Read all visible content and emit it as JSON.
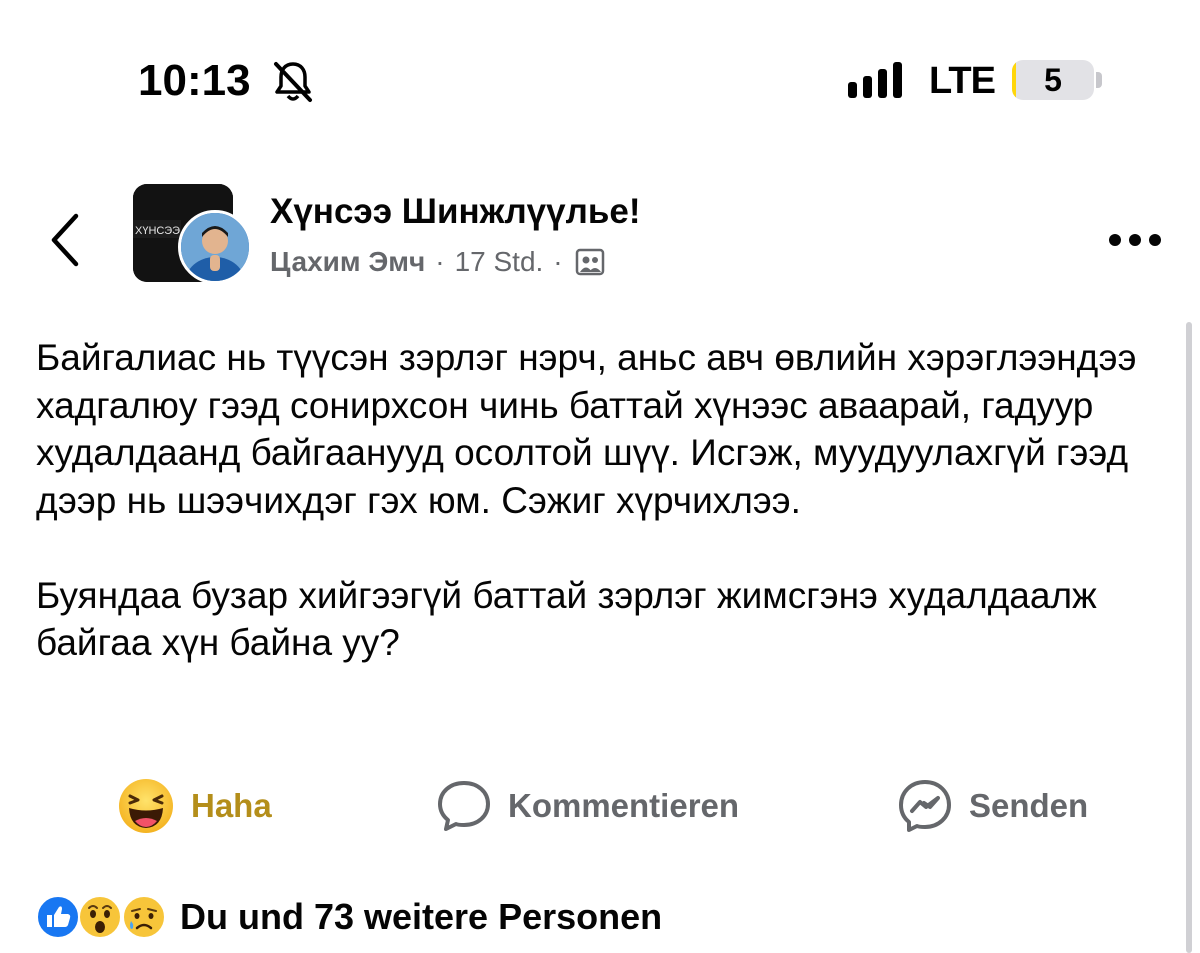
{
  "status_bar": {
    "time": "10:13",
    "network": "LTE",
    "battery": "5",
    "battery_level_percent": 5,
    "icons": [
      "bell-slash-icon",
      "signal-icon",
      "battery-icon"
    ]
  },
  "header": {
    "back_icon": "chevron-left-icon",
    "group_name": "Хүнсээ Шинжлүүлье!",
    "author": "Цахим Эмч",
    "separator": "·",
    "time_ago": "17 Std.",
    "audience_icon": "group-audience-icon",
    "more_icon": "more-icon"
  },
  "post": {
    "paragraphs": [
      "Байгалиас нь түүсэн зэрлэг нэрч, аньс авч өвлийн хэрэглээндээ хадгалюу гээд сонирхсон чинь баттай хүнээс аваарай, гадуур худалдаанд байгаанууд осолтой шүү. Исгэж, муудуулахгүй гээд дээр нь шээчихдэг гэх юм. Сэжиг хүрчихлээ.",
      "Буяндаа бузар хийгээгүй баттай зэрлэг жимсгэнэ худалдаалж байгаа хүн байна уу?"
    ]
  },
  "actions": {
    "haha_label": "Haha",
    "comment_label": "Kommentieren",
    "send_label": "Senden"
  },
  "reactions": {
    "icons": [
      "like-icon",
      "wow-icon",
      "sad-icon"
    ],
    "summary": "Du und 73 weitere Personen"
  },
  "colors": {
    "haha": "#b48e1a",
    "secondary_text": "#65676b",
    "like_blue": "#1877f2",
    "battery_fill": "#ffd60a"
  }
}
